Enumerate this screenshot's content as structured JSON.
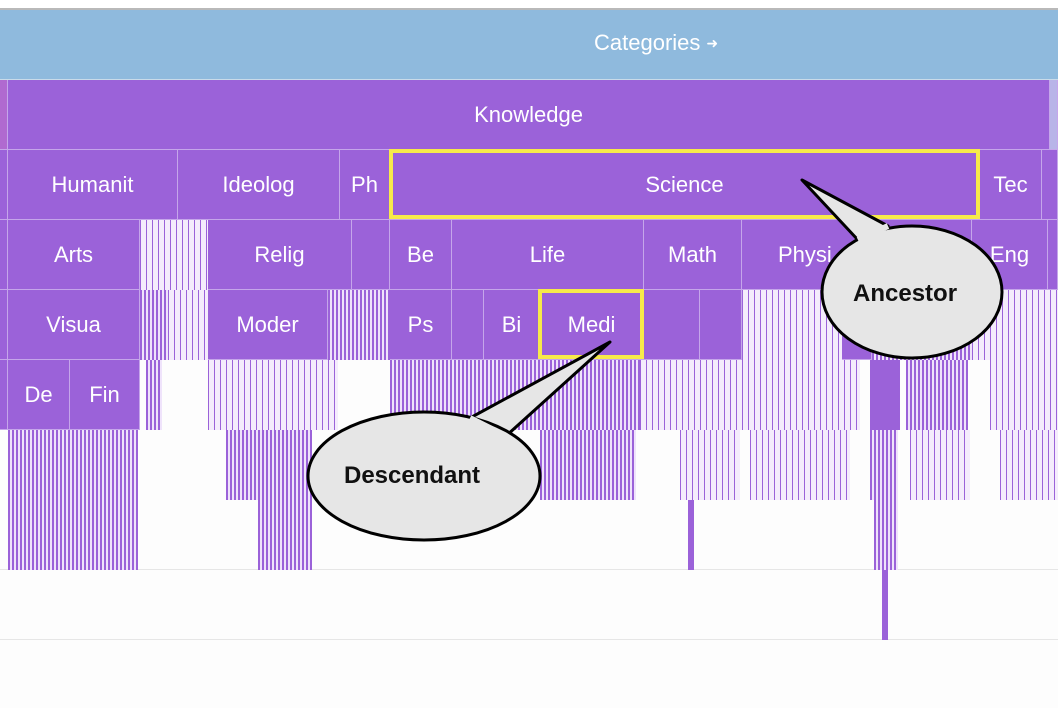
{
  "header": {
    "title": "Categories",
    "arrow_icon": "arrow-right-icon"
  },
  "level1": {
    "knowledge": "Knowledge"
  },
  "level2": {
    "humanities": "Humanit",
    "ideology": "Ideolog",
    "philosophy": "Ph",
    "science": "Science",
    "technology": "Tec"
  },
  "level3": {
    "arts": "Arts",
    "religion": "Relig",
    "behavioral": "Be",
    "life": "Life",
    "math": "Math",
    "physical": "Physi",
    "engineering": "Eng"
  },
  "level4": {
    "visual": "Visua",
    "modern": "Moder",
    "psychology": "Ps",
    "biology": "Bi",
    "medicine": "Medi"
  },
  "level5": {
    "design": "De",
    "fine": "Fin"
  },
  "annotations": {
    "ancestor": "Ancestor",
    "descendant": "Descendant"
  },
  "colors": {
    "header": "#8fbadd",
    "cell": "#9b62d9",
    "highlight": "#f7ea4a",
    "callout_fill": "#e6e6e6"
  }
}
